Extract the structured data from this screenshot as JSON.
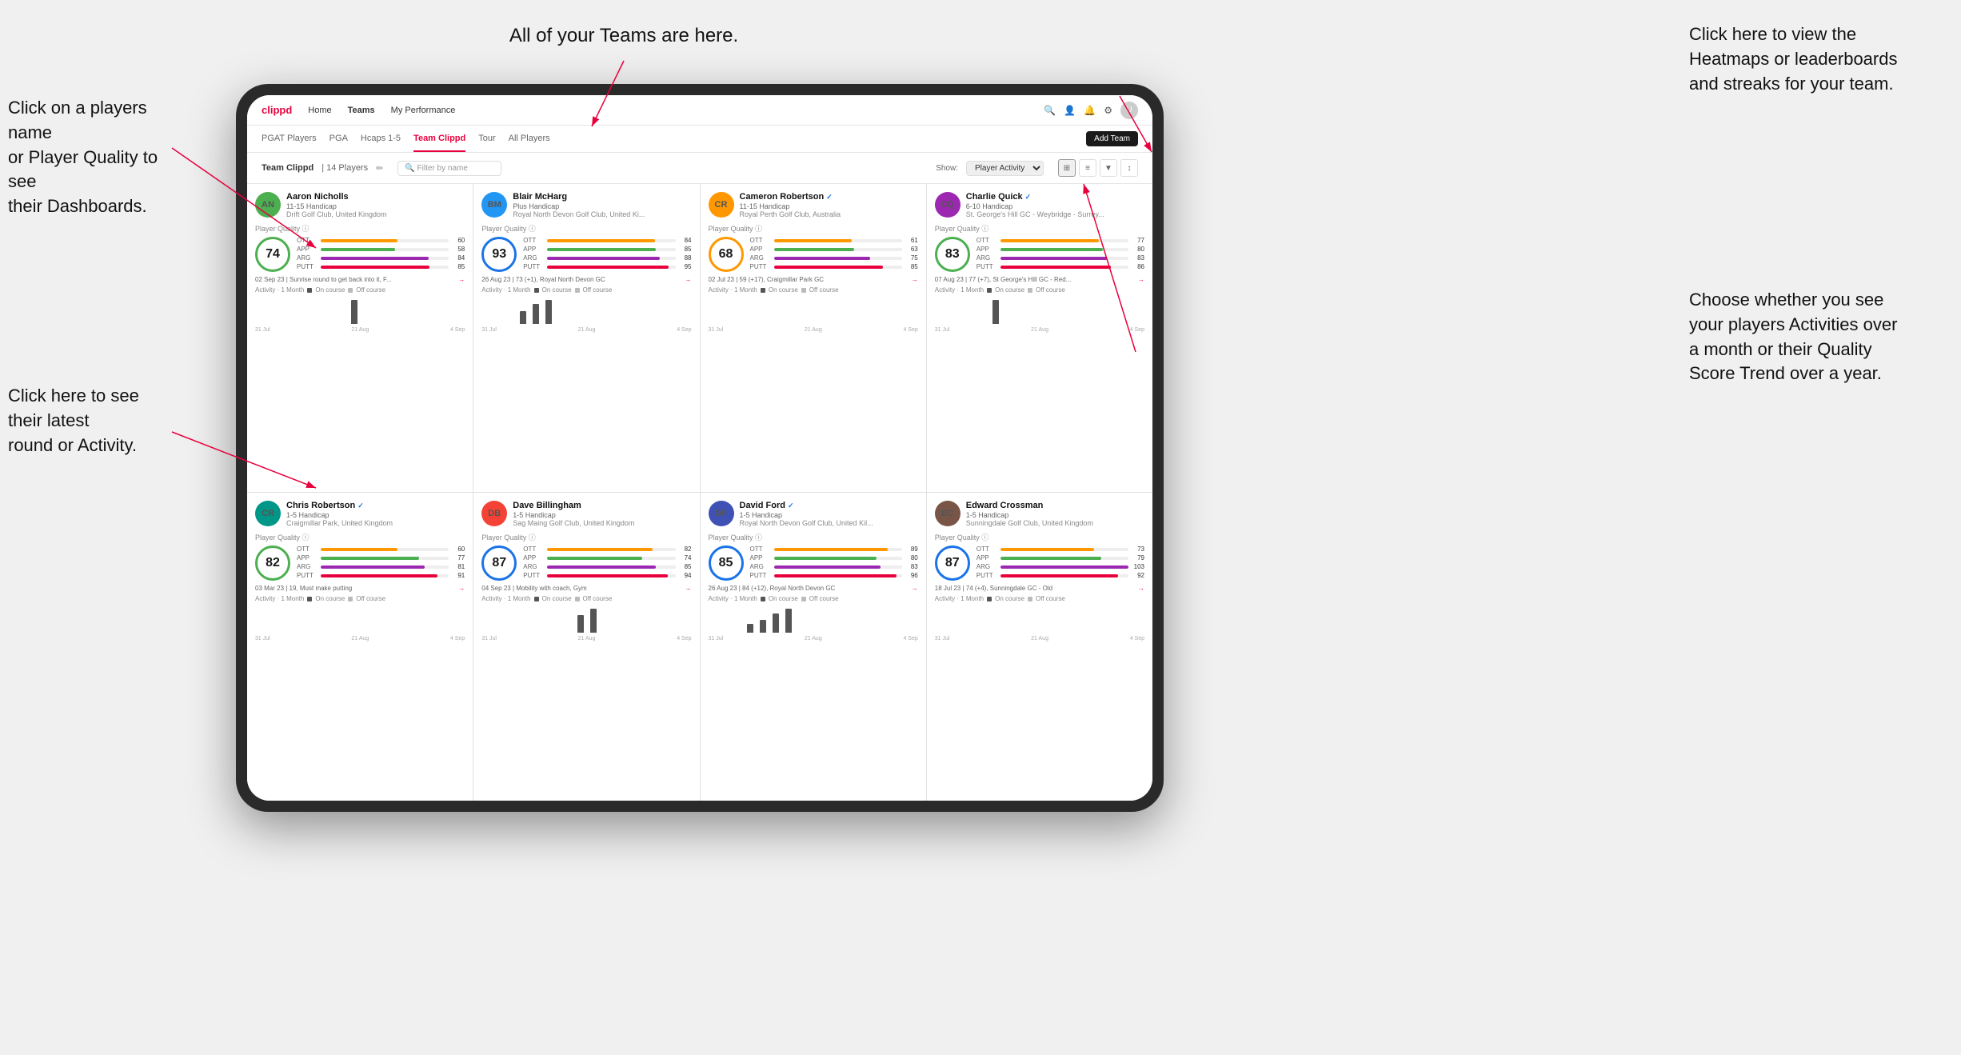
{
  "annotations": {
    "left1": "Click on a players name\nor Player Quality to see\ntheir Dashboards.",
    "left2": "Click here to see their latest\nround or Activity.",
    "top": "All of your Teams are here.",
    "right_top_title": "Click here to view the\nHeatmaps or leaderboards\nand streaks for your team.",
    "right_bottom": "Choose whether you see\nyour players Activities over\na month or their Quality\nScore Trend over a year."
  },
  "nav": {
    "logo": "clippd",
    "items": [
      "Home",
      "Teams",
      "My Performance"
    ],
    "active": "Teams"
  },
  "sub_nav": {
    "items": [
      "PGAT Players",
      "PGA",
      "Hcaps 1-5",
      "Team Clippd",
      "Tour",
      "All Players"
    ],
    "active": "Team Clippd",
    "add_button": "Add Team"
  },
  "team_header": {
    "name": "Team Clippd",
    "separator": "|",
    "count": "14 Players",
    "search_placeholder": "Filter by name",
    "show_label": "Show:",
    "show_select": "Player Activity",
    "add_button": "Add Team"
  },
  "players": [
    {
      "name": "Aaron Nicholls",
      "hcp": "11-15 Handicap",
      "club": "Drift Golf Club, United Kingdom",
      "verified": false,
      "quality": 74,
      "quality_color": "#1a73e8",
      "stats": {
        "ott": 60,
        "app": 58,
        "arg": 84,
        "putt": 85
      },
      "latest_round": "02 Sep 23 | Sunrise round to get back into it, F...",
      "activity_bars": [
        0,
        0,
        0,
        0,
        0,
        0,
        0,
        0,
        0,
        0,
        0,
        0,
        0,
        0,
        0,
        0,
        0,
        0,
        0,
        0,
        14,
        0,
        0
      ],
      "activity_dates": [
        "31 Jul",
        "21 Aug",
        "4 Sep"
      ]
    },
    {
      "name": "Blair McHarg",
      "hcp": "Plus Handicap",
      "club": "Royal North Devon Golf Club, United Ki...",
      "verified": false,
      "quality": 93,
      "quality_color": "#1a73e8",
      "stats": {
        "ott": 84,
        "app": 85,
        "arg": 88,
        "putt": 95
      },
      "latest_round": "26 Aug 23 | 73 (+1), Royal North Devon GC",
      "activity_bars": [
        0,
        0,
        0,
        0,
        0,
        0,
        0,
        0,
        12,
        0,
        18,
        0,
        22,
        0,
        0,
        0,
        0,
        0,
        0,
        0,
        0,
        0,
        0
      ],
      "activity_dates": [
        "31 Jul",
        "21 Aug",
        "4 Sep"
      ]
    },
    {
      "name": "Cameron Robertson",
      "hcp": "11-15 Handicap",
      "club": "Royal Perth Golf Club, Australia",
      "verified": true,
      "quality": 68,
      "quality_color": "#4CAF50",
      "stats": {
        "ott": 61,
        "app": 63,
        "arg": 75,
        "putt": 85
      },
      "latest_round": "02 Jul 23 | 59 (+17), Craigmillar Park GC",
      "activity_bars": [
        0,
        0,
        0,
        0,
        0,
        0,
        0,
        0,
        0,
        0,
        0,
        0,
        0,
        0,
        0,
        0,
        0,
        0,
        0,
        0,
        0,
        0,
        0
      ],
      "activity_dates": [
        "31 Jul",
        "21 Aug",
        "4 Sep"
      ]
    },
    {
      "name": "Charlie Quick",
      "hcp": "6-10 Handicap",
      "club": "St. George's Hill GC - Weybridge - Surrey...",
      "verified": true,
      "quality": 83,
      "quality_color": "#1a73e8",
      "stats": {
        "ott": 77,
        "app": 80,
        "arg": 83,
        "putt": 86
      },
      "latest_round": "07 Aug 23 | 77 (+7), St George's Hill GC - Red...",
      "activity_bars": [
        0,
        0,
        0,
        0,
        0,
        0,
        0,
        0,
        0,
        0,
        0,
        0,
        10,
        0,
        0,
        0,
        0,
        0,
        0,
        0,
        0,
        0,
        0
      ],
      "activity_dates": [
        "31 Jul",
        "21 Aug",
        "4 Sep"
      ]
    },
    {
      "name": "Chris Robertson",
      "hcp": "1-5 Handicap",
      "club": "Craigmillar Park, United Kingdom",
      "verified": true,
      "quality": 82,
      "quality_color": "#1a73e8",
      "stats": {
        "ott": 60,
        "app": 77,
        "arg": 81,
        "putt": 91
      },
      "latest_round": "03 Mar 23 | 19, Must make putting",
      "activity_bars": [
        0,
        0,
        0,
        0,
        0,
        0,
        0,
        0,
        0,
        0,
        0,
        0,
        0,
        0,
        0,
        0,
        0,
        0,
        0,
        0,
        0,
        0,
        0
      ],
      "activity_dates": [
        "31 Jul",
        "21 Aug",
        "4 Sep"
      ]
    },
    {
      "name": "Dave Billingham",
      "hcp": "1-5 Handicap",
      "club": "Sag Maing Golf Club, United Kingdom",
      "verified": false,
      "quality": 87,
      "quality_color": "#1a73e8",
      "stats": {
        "ott": 82,
        "app": 74,
        "arg": 85,
        "putt": 94
      },
      "latest_round": "04 Sep 23 | Mobility with coach, Gym",
      "activity_bars": [
        0,
        0,
        0,
        0,
        0,
        0,
        0,
        0,
        0,
        0,
        0,
        0,
        0,
        0,
        0,
        0,
        0,
        0,
        0,
        0,
        8,
        0,
        11
      ],
      "activity_dates": [
        "31 Jul",
        "21 Aug",
        "4 Sep"
      ]
    },
    {
      "name": "David Ford",
      "hcp": "1-5 Handicap",
      "club": "Royal North Devon Golf Club, United Kil...",
      "verified": true,
      "quality": 85,
      "quality_color": "#1a73e8",
      "stats": {
        "ott": 89,
        "app": 80,
        "arg": 83,
        "putt": 96
      },
      "latest_round": "26 Aug 23 | 84 (+12), Royal North Devon GC",
      "activity_bars": [
        0,
        0,
        0,
        0,
        0,
        0,
        0,
        0,
        10,
        0,
        15,
        0,
        22,
        0,
        28,
        0,
        0,
        0,
        0,
        0,
        0,
        0,
        0
      ],
      "activity_dates": [
        "31 Jul",
        "21 Aug",
        "4 Sep"
      ]
    },
    {
      "name": "Edward Crossman",
      "hcp": "1-5 Handicap",
      "club": "Sunningdale Golf Club, United Kingdom",
      "verified": false,
      "quality": 87,
      "quality_color": "#1a73e8",
      "stats": {
        "ott": 73,
        "app": 79,
        "arg": 103,
        "putt": 92
      },
      "latest_round": "18 Jul 23 | 74 (+4), Sunningdale GC - Old",
      "activity_bars": [
        0,
        0,
        0,
        0,
        0,
        0,
        0,
        0,
        0,
        0,
        0,
        0,
        0,
        0,
        0,
        0,
        0,
        0,
        0,
        0,
        0,
        0,
        0
      ],
      "activity_dates": [
        "31 Jul",
        "21 Aug",
        "4 Sep"
      ]
    }
  ],
  "chart": {
    "on_course_color": "#555",
    "off_course_color": "#aaa",
    "legend_on": "On course",
    "legend_off": "Off course"
  }
}
